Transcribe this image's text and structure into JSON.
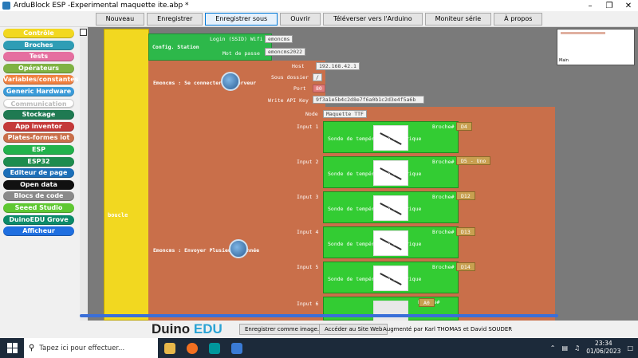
{
  "window": {
    "title": "ArduBlock ESP -Experimental maquette ite.abp *"
  },
  "toolbar": [
    {
      "label": "Nouveau"
    },
    {
      "label": "Enregistrer"
    },
    {
      "label": "Enregistrer sous"
    },
    {
      "label": "Ouvrir"
    },
    {
      "label": "Téléverser vers l'Arduino"
    },
    {
      "label": "Moniteur série"
    },
    {
      "label": "À propos"
    }
  ],
  "palette": [
    {
      "label": "Contrôle",
      "color": "#f2d820",
      "text": "#fff"
    },
    {
      "label": "Broches",
      "color": "#2f9db5",
      "text": "#fff"
    },
    {
      "label": "Tests",
      "color": "#e56fa0",
      "text": "#fff"
    },
    {
      "label": "Opérateurs",
      "color": "#7fb243",
      "text": "#fff"
    },
    {
      "label": "Variables/constantes",
      "color": "#f08040",
      "text": "#fff"
    },
    {
      "label": "Generic Hardware",
      "color": "#3a9bd9",
      "text": "#fff"
    },
    {
      "label": "Communication",
      "color": "#ffffff",
      "text": "#bbb"
    },
    {
      "label": "Stockage",
      "color": "#1f7a52",
      "text": "#fff"
    },
    {
      "label": "App inventor",
      "color": "#c43a3a",
      "text": "#fff"
    },
    {
      "label": "Plates-formes iot",
      "color": "#c96f4a",
      "text": "#fff"
    },
    {
      "label": "ESP",
      "color": "#22b24c",
      "text": "#fff"
    },
    {
      "label": "ESP32",
      "color": "#1e8c4e",
      "text": "#fff"
    },
    {
      "label": "Editeur de page web",
      "color": "#1c6fb8",
      "text": "#fff"
    },
    {
      "label": "Open data",
      "color": "#111111",
      "text": "#fff"
    },
    {
      "label": "Blocs de code",
      "color": "#8a8a8a",
      "text": "#fff"
    },
    {
      "label": "Seeed Studio Grove",
      "color": "#5fc832",
      "text": "#fff"
    },
    {
      "label": "DuinoEDU Grove Add",
      "color": "#0b8a6a",
      "text": "#fff"
    },
    {
      "label": "Afficheur",
      "color": "#1f6fe0",
      "text": "#fff"
    }
  ],
  "canvas": {
    "loop_label": "boucle",
    "config": {
      "title": "Config. Station",
      "ssid_label": "Login (SSID) Wifi",
      "ssid_value": "emoncms",
      "password_label": "Mot de passe",
      "password_value": "emoncms2022"
    },
    "connect": {
      "title": "Emoncms : Se connecter au serveur",
      "host_label": "Host",
      "host_value": "192.168.42.1",
      "subdir_label": "Sous dossier",
      "subdir_value": "/",
      "port_label": "Port",
      "port_value": "80",
      "apikey_label": "Write API Key",
      "apikey_value": "9f3a1e5b4c2d8e7f6a0b1c2d3e4f5a6b"
    },
    "send": {
      "title": "Emoncms : Envoyer Plusieurs donnée",
      "node_label": "Node",
      "node_value": "Maquette TTF",
      "inputs": [
        {
          "label": "Input 1",
          "sensor": "Sonde de température numérique",
          "pin_label": "Broche#",
          "pin": "D4"
        },
        {
          "label": "Input 2",
          "sensor": "Sonde de température numérique",
          "pin_label": "Broche#",
          "pin": "D5 - Uno"
        },
        {
          "label": "Input 3",
          "sensor": "Sonde de température numérique",
          "pin_label": "Broche#",
          "pin": "D12"
        },
        {
          "label": "Input 4",
          "sensor": "Sonde de température numérique",
          "pin_label": "Broche#",
          "pin": "D13"
        },
        {
          "label": "Input 5",
          "sensor": "Sonde de température numérique",
          "pin_label": "Broche#",
          "pin": "D14"
        },
        {
          "label": "Input 6",
          "sensor": "",
          "pin_label": "Broche#",
          "pin": "A0"
        }
      ]
    },
    "minimap_label": "Main"
  },
  "footer": {
    "logo_main": "Duino",
    "logo_accent": "EDU",
    "save_image_label": "Enregistrer comme image...",
    "website_label": "Accéder au Site Web",
    "credits": "Augmenté par Karl THOMAS et David SOUDER"
  },
  "taskbar": {
    "search_placeholder": "Tapez ici pour effectuer...",
    "time": "23:34",
    "date": "01/06/2023"
  }
}
